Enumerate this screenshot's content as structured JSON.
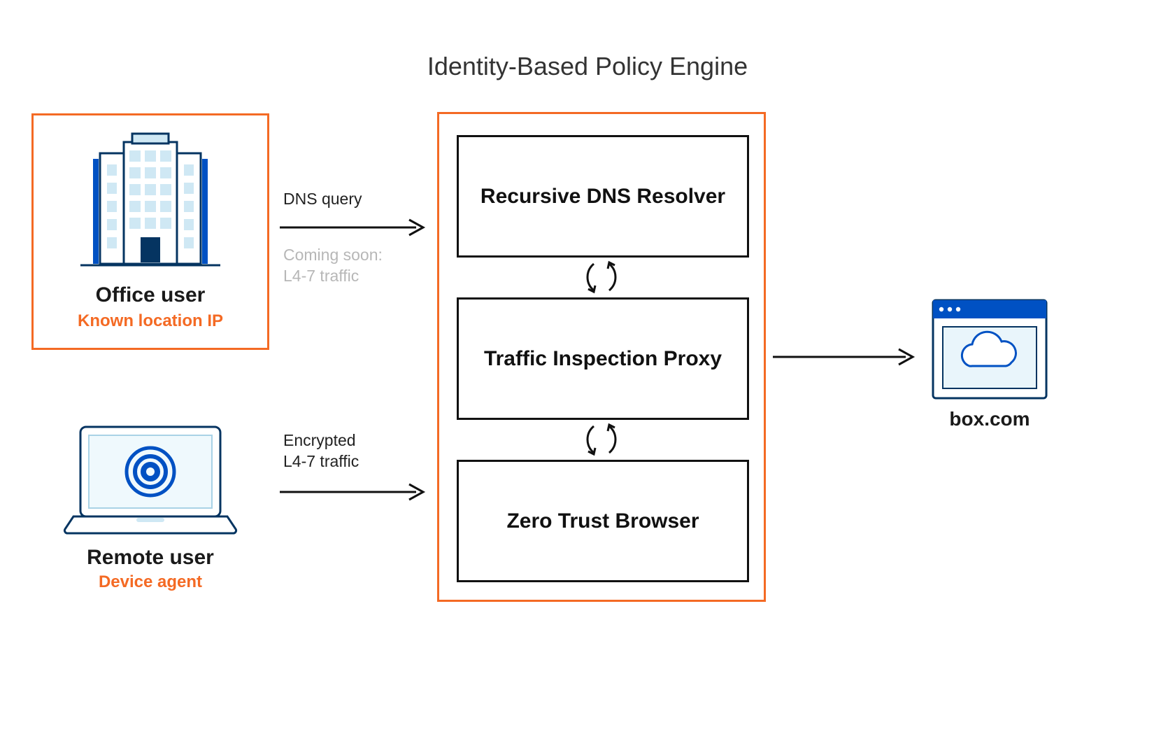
{
  "title": "Identity-Based Policy Engine",
  "office": {
    "title": "Office user",
    "subtitle": "Known location IP"
  },
  "remote": {
    "title": "Remote user",
    "subtitle": "Device agent"
  },
  "arrows": {
    "office_label": "DNS query",
    "office_soon": "Coming soon:\nL4-7 traffic",
    "remote_label": "Encrypted\nL4-7 traffic"
  },
  "engine": {
    "box1": "Recursive DNS Resolver",
    "box2": "Traffic Inspection Proxy",
    "box3": "Zero Trust Browser"
  },
  "destination": {
    "label": "box.com"
  },
  "colors": {
    "accent": "#f46a24",
    "blue": "#0051c3",
    "lightblue": "#cfe8f4"
  }
}
